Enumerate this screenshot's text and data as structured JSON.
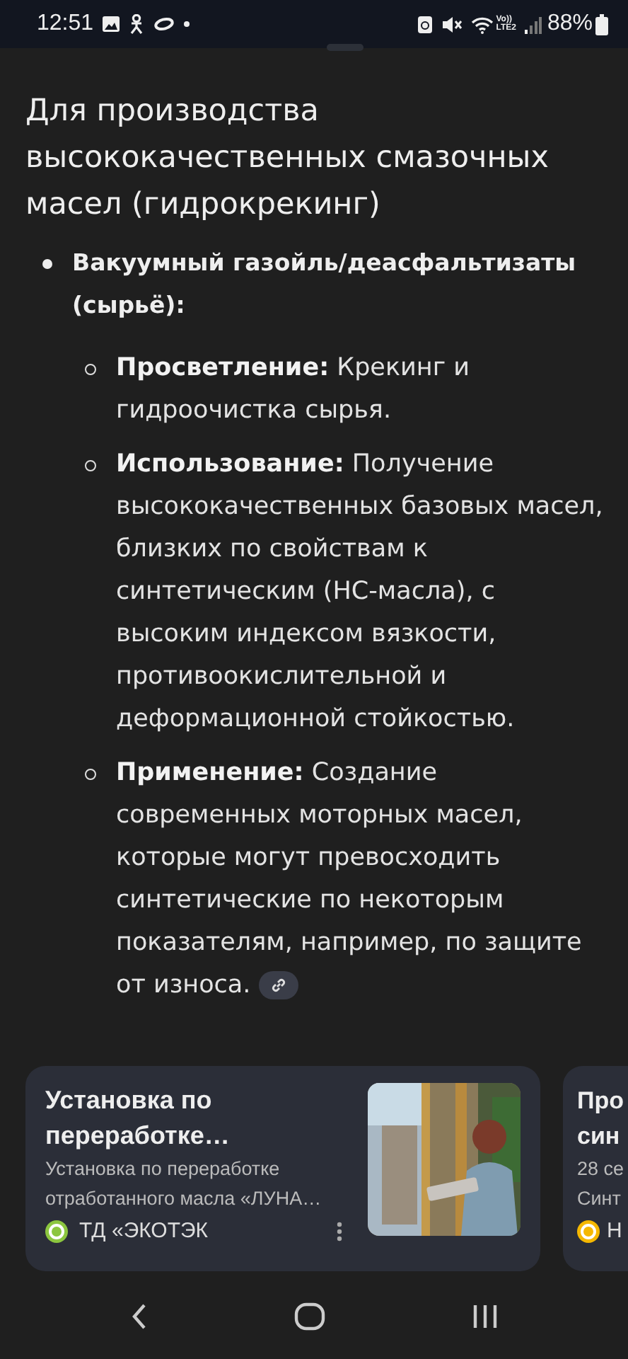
{
  "status_bar": {
    "time": "12:51",
    "network_top": "Vo))",
    "network_bottom": "LTE2",
    "battery": "88%"
  },
  "heading": "Для производства высококачественных смазочных масел (гидрокрекинг)",
  "list": [
    {
      "label": "Вакуумный газойль/деасфальтизаты (сырьё):",
      "children": [
        {
          "label": "Просветление:",
          "text": "Крекинг и гидроочистка сырья.",
          "link": false
        },
        {
          "label": "Использование:",
          "text": "Получение высококачественных базовых масел, близких по свойствам к синтетическим (НС-масла), с высоким индексом вязкости, противоокислительной и деформационной стойкостью.",
          "link": false
        },
        {
          "label": "Применение:",
          "text": "Создание современных моторных масел, которые могут превосходить синтетические по некоторым показателям, например, по защите от износа.",
          "link": true
        }
      ]
    }
  ],
  "cards": [
    {
      "title_lines": [
        "Установка по",
        "переработке…"
      ],
      "snippet_lines": [
        "Установка по переработке",
        "отработанного масла «ЛУНА…"
      ],
      "source": "ТД «ЭКОТЭК",
      "color": "#8cc63f",
      "thumbnail": {
        "kind": "picture"
      }
    },
    {
      "title_lines": [
        "Про",
        "син"
      ],
      "snippet_lines": [
        "28 се",
        "Синт"
      ],
      "source": "Н",
      "color": "#f5b800"
    }
  ]
}
